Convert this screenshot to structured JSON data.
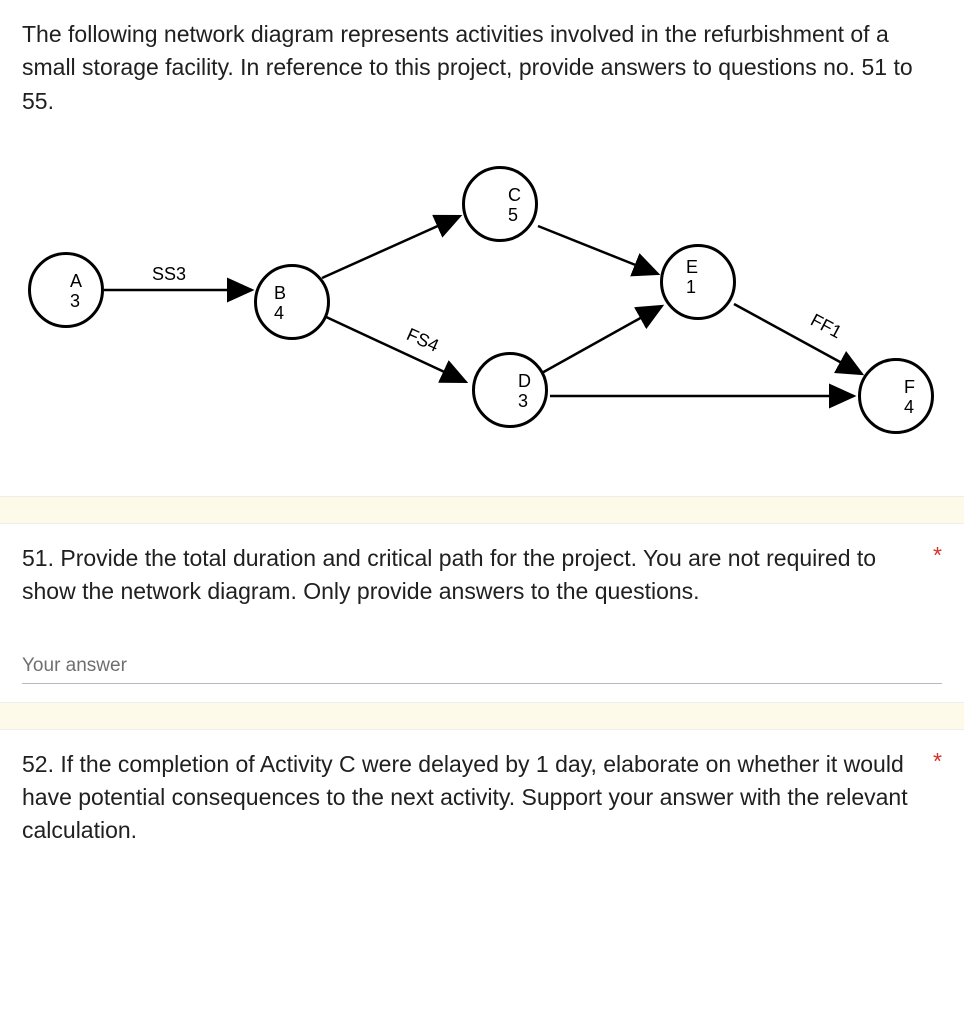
{
  "intro": "The following network diagram represents activities involved in the refurbishment of a small storage facility. In reference to this project, provide answers to questions no. 51 to 55.",
  "diagram": {
    "nodes": {
      "A": {
        "letter": "A",
        "dur": "3"
      },
      "B": {
        "letter": "B",
        "dur": "4"
      },
      "C": {
        "letter": "C",
        "dur": "5"
      },
      "D": {
        "letter": "D",
        "dur": "3"
      },
      "E": {
        "letter": "E",
        "dur": "1"
      },
      "F": {
        "letter": "F",
        "dur": "4"
      }
    },
    "edge_labels": {
      "ab": "SS3",
      "bd": "FS4",
      "ef": "FF1"
    }
  },
  "q51": {
    "text": "51. Provide the total duration and critical path for the project. You are not required to show the network diagram. Only provide answers to the questions.",
    "required": "*",
    "placeholder": "Your answer"
  },
  "q52": {
    "text": "52. If the completion of Activity C were delayed by 1 day, elaborate on whether it would have potential consequences to the next activity. Support your answer with the relevant calculation.",
    "required": "*"
  }
}
